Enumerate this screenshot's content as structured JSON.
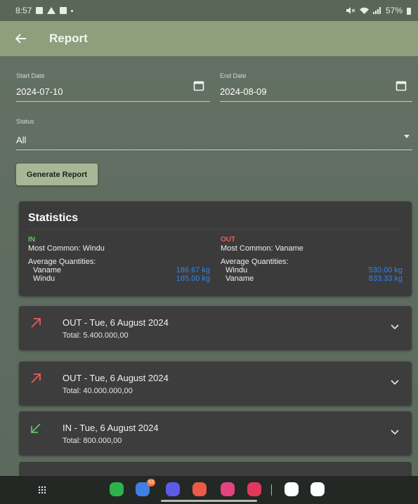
{
  "status_bar": {
    "time": "8:57",
    "battery": "57%"
  },
  "app_bar": {
    "title": "Report"
  },
  "filters": {
    "start_date_label": "Start Date",
    "start_date_value": "2024-07-10",
    "end_date_label": "End Date",
    "end_date_value": "2024-08-09",
    "status_label": "Status",
    "status_value": "All",
    "generate_button": "Generate Report"
  },
  "statistics": {
    "title": "Statistics",
    "in": {
      "label": "IN",
      "most_common": "Most Common: Windu",
      "avg_label": "Average Quantities:",
      "items": [
        {
          "name": "Vaname",
          "qty": "186.67 kg"
        },
        {
          "name": "Windu",
          "qty": "165.00 kg"
        }
      ]
    },
    "out": {
      "label": "OUT",
      "most_common": "Most Common: Vaname",
      "avg_label": "Average Quantities:",
      "items": [
        {
          "name": "Windu",
          "qty": "530.00 kg"
        },
        {
          "name": "Vaname",
          "qty": "833.33 kg"
        }
      ]
    }
  },
  "transactions": [
    {
      "direction": "out",
      "title": "OUT - Tue, 6 August 2024",
      "total": "Total: 5.400.000,00"
    },
    {
      "direction": "out",
      "title": "OUT - Tue, 6 August 2024",
      "total": "Total: 40.000.000,00"
    },
    {
      "direction": "in",
      "title": "IN - Tue, 6 August 2024",
      "total": "Total: 800.000,00"
    }
  ],
  "dock": {
    "messages_badge": "53"
  },
  "colors": {
    "in": "#5fc65c",
    "out": "#ef5a55",
    "quantity": "#2e85ef",
    "app_bar": "#8f9f7d",
    "button": "#a8b897"
  }
}
